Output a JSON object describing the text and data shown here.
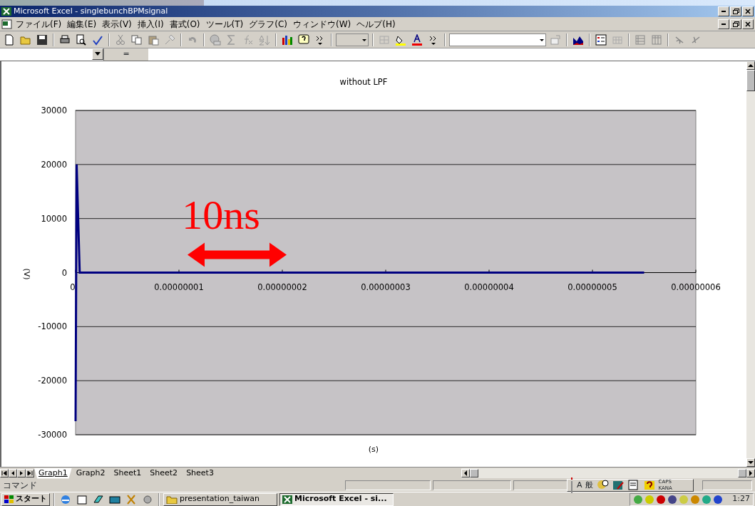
{
  "window": {
    "title": "Microsoft Excel - singlebunchBPMsignal"
  },
  "menu": [
    "ファイル(F)",
    "編集(E)",
    "表示(V)",
    "挿入(I)",
    "書式(O)",
    "ツール(T)",
    "グラフ(C)",
    "ウィンドウ(W)",
    "ヘルプ(H)"
  ],
  "formula_bar": {
    "equals": "="
  },
  "chart": {
    "chart_data": {
      "type": "line",
      "title": "without LPF",
      "xlabel": "(s)",
      "ylabel": "(V)",
      "x": [
        0,
        1e-10,
        4e-10,
        5.5e-08
      ],
      "series": [
        {
          "color": "#000080",
          "values": [
            -27500,
            20000,
            0,
            0
          ]
        }
      ],
      "xlim": [
        0,
        6e-08
      ],
      "ylim": [
        -30000,
        30000
      ],
      "xticks": [
        {
          "value": 0,
          "label": "0"
        },
        {
          "value": 1e-08,
          "label": "0.00000001"
        },
        {
          "value": 2e-08,
          "label": "0.00000002"
        },
        {
          "value": 3e-08,
          "label": "0.00000003"
        },
        {
          "value": 4e-08,
          "label": "0.00000004"
        },
        {
          "value": 5e-08,
          "label": "0.00000005"
        },
        {
          "value": 6e-08,
          "label": "0.00000006"
        }
      ],
      "yticks": [
        -30000,
        -20000,
        -10000,
        0,
        10000,
        20000,
        30000
      ],
      "grid": true,
      "annotations": [
        "10ns"
      ]
    }
  },
  "sheet_tabs": [
    {
      "label": "Graph1",
      "selected": true
    },
    {
      "label": "Graph2",
      "selected": false
    },
    {
      "label": "Sheet1",
      "selected": false
    },
    {
      "label": "Sheet2",
      "selected": false
    },
    {
      "label": "Sheet3",
      "selected": false
    }
  ],
  "status_bar": {
    "text": "コマンド"
  },
  "ime_bar": {
    "mode": "A",
    "kanji": "般",
    "caps": "CAPS",
    "kana": "KANA"
  },
  "taskbar": {
    "start": "スタート",
    "tasks": [
      {
        "label": "presentation_taiwan",
        "selected": false
      },
      {
        "label": "Microsoft Excel - si...",
        "selected": true
      }
    ],
    "clock": "1:27"
  }
}
